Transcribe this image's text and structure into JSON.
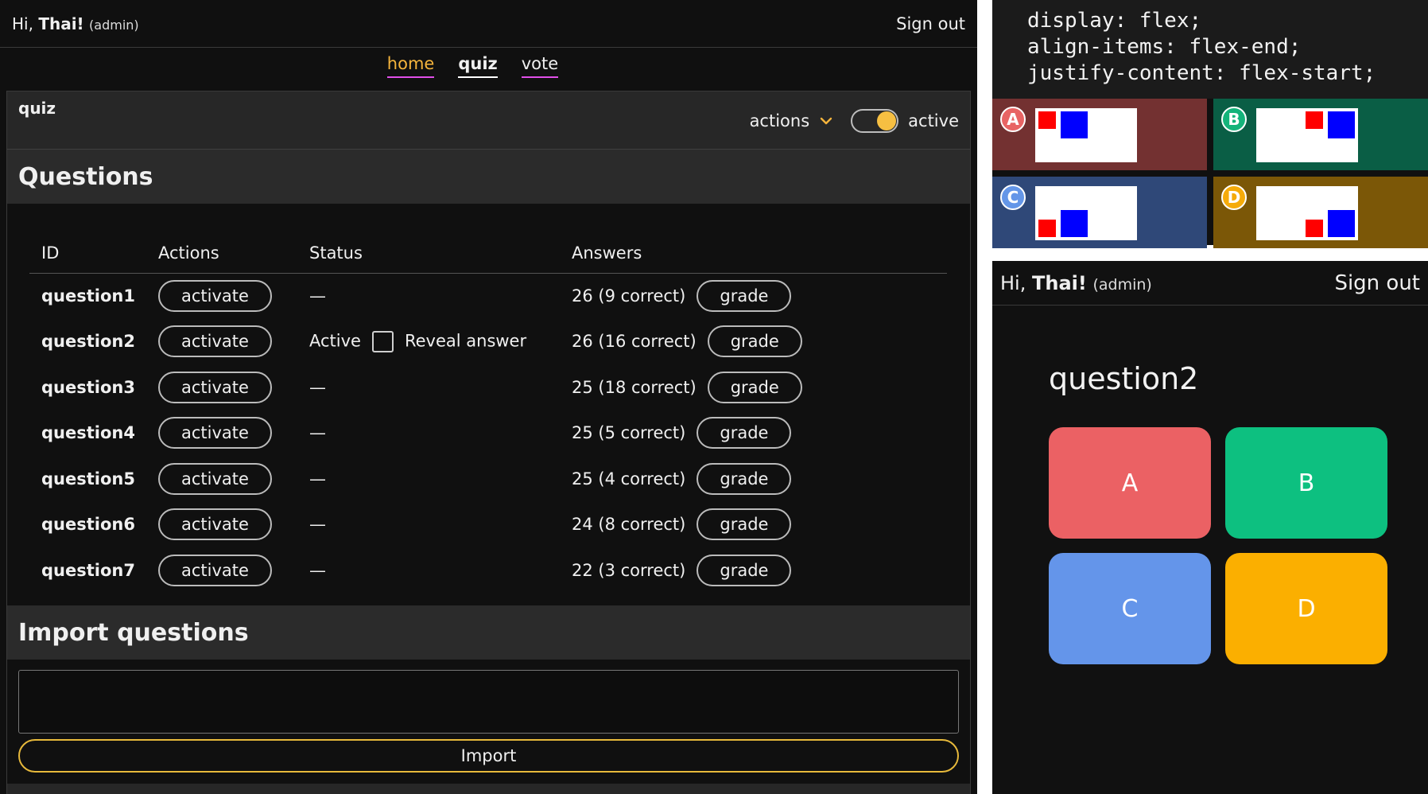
{
  "admin": {
    "header": {
      "greeting_prefix": "Hi, ",
      "user": "Thai!",
      "role": "(admin)",
      "sign_out": "Sign out"
    },
    "nav": {
      "home": "home",
      "quiz": "quiz",
      "vote": "vote"
    },
    "panel": {
      "title": "quiz",
      "actions_label": "actions",
      "active_label": "active",
      "questions_heading": "Questions",
      "columns": [
        "ID",
        "Actions",
        "Status",
        "Answers"
      ],
      "rows": [
        {
          "id": "question1",
          "action": "activate",
          "status": "—",
          "answers": "26 (9 correct)",
          "grade": "grade"
        },
        {
          "id": "question2",
          "action": "activate",
          "status": "Active",
          "reveal": "Reveal answer",
          "answers": "26 (16 correct)",
          "grade": "grade"
        },
        {
          "id": "question3",
          "action": "activate",
          "status": "—",
          "answers": "25 (18 correct)",
          "grade": "grade"
        },
        {
          "id": "question4",
          "action": "activate",
          "status": "—",
          "answers": "25 (5 correct)",
          "grade": "grade"
        },
        {
          "id": "question5",
          "action": "activate",
          "status": "—",
          "answers": "25 (4 correct)",
          "grade": "grade"
        },
        {
          "id": "question6",
          "action": "activate",
          "status": "—",
          "answers": "24 (8 correct)",
          "grade": "grade"
        },
        {
          "id": "question7",
          "action": "activate",
          "status": "—",
          "answers": "22 (3 correct)",
          "grade": "grade"
        }
      ],
      "import_heading": "Import questions",
      "import_button": "Import"
    },
    "colors": {
      "accent": "#f5b43c",
      "nav_underline": "#e04fe8",
      "toggle_knob": "#f6bf42",
      "import_border": "#e7b93b"
    }
  },
  "css_demo": {
    "code_lines": [
      "display: flex;",
      "align-items: flex-end;",
      "justify-content: flex-start;"
    ],
    "cells": [
      {
        "label": "A",
        "bg": "#733131",
        "badge": "#e86464"
      },
      {
        "label": "B",
        "bg": "#0a5e45",
        "badge": "#14b37a"
      },
      {
        "label": "C",
        "bg": "#2f4878",
        "badge": "#6496e8"
      },
      {
        "label": "D",
        "bg": "#7b5707",
        "badge": "#f5ab0a"
      }
    ]
  },
  "player": {
    "header": {
      "greeting_prefix": "Hi, ",
      "user": "Thai!",
      "role": "(admin)",
      "sign_out": "Sign out"
    },
    "question": "question2",
    "options": [
      {
        "label": "A",
        "color": "#eb6164"
      },
      {
        "label": "B",
        "color": "#0dc080"
      },
      {
        "label": "C",
        "color": "#6495ea"
      },
      {
        "label": "D",
        "color": "#fbaf00"
      }
    ]
  }
}
